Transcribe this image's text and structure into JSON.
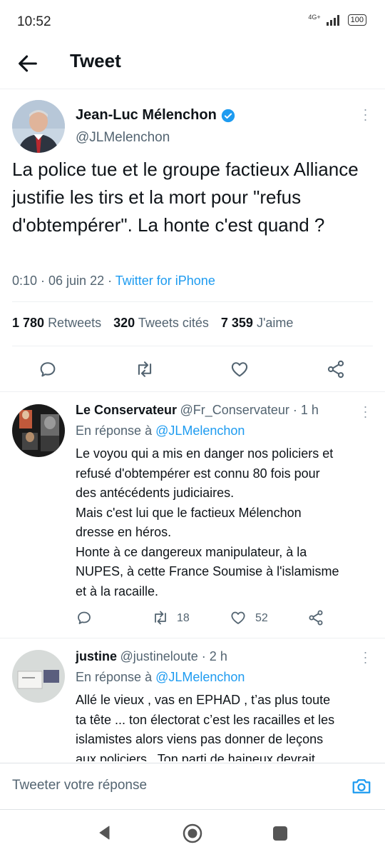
{
  "status_bar": {
    "time": "10:52",
    "network": "4G+",
    "battery": "100"
  },
  "header": {
    "title": "Tweet"
  },
  "tweet": {
    "author_name": "Jean-Luc Mélenchon",
    "author_handle": "@JLMelenchon",
    "text": "La police tue et le groupe factieux Alliance justifie les tirs et la mort pour \"refus d'obtempérer\". La honte c'est quand ?",
    "time": "0:10 · 06 juin 22 · ",
    "source": "Twitter for iPhone",
    "stats": {
      "retweets": "1 780",
      "retweets_label": "Retweets",
      "quotes": "320",
      "quotes_label": "Tweets cités",
      "likes": "7 359",
      "likes_label": "J'aime"
    }
  },
  "replies": [
    {
      "name": "Le Conservateur",
      "handle_time": "@Fr_Conservateur · 1 h",
      "reply_prefix": "En réponse à ",
      "reply_to": "@JLMelenchon",
      "lines": [
        "Le voyou qui a mis en danger nos policiers et",
        "refusé d'obtempérer est connu 80 fois pour",
        "des antécédents judiciaires.",
        "Mais c'est lui que le factieux Mélenchon",
        "dresse en héros.",
        "Honte à ce dangereux manipulateur, à la",
        "NUPES, à cette France Soumise à l'islamisme",
        "et à la racaille."
      ],
      "retweets": "18",
      "likes": "52"
    },
    {
      "name": "justine",
      "handle_time": "@justineloute · 2 h",
      "reply_prefix": "En réponse à ",
      "reply_to": "@JLMelenchon",
      "lines": [
        "Allé le vieux , vas en EPHAD , t’as plus toute",
        "ta tête ... ton électorat c’est les racailles et les",
        "islamistes alors viens pas donner de leçons",
        "aux policiers . Ton parti de haineux devrait"
      ]
    }
  ],
  "composer": {
    "placeholder": "Tweeter votre réponse"
  },
  "colors": {
    "accent": "#1d9bf0",
    "text": "#0f1419",
    "secondary": "#536471"
  }
}
